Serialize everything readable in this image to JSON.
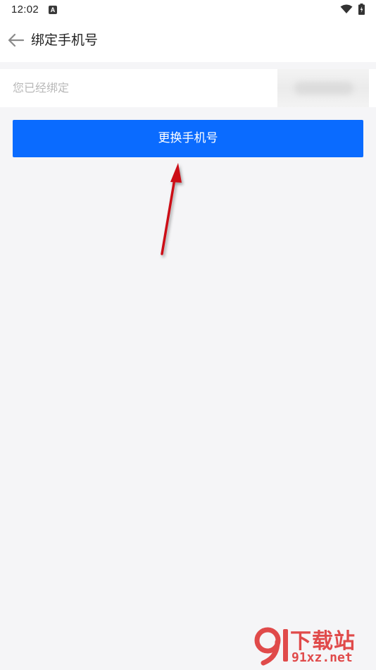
{
  "status_bar": {
    "time": "12:02",
    "notification_glyph": "A",
    "icons": [
      "notification-icon",
      "wifi-icon",
      "battery-icon"
    ]
  },
  "header": {
    "title": "绑定手机号",
    "back_icon": "arrow-left-icon"
  },
  "bound_phone": {
    "label": "您已经绑定",
    "value_hidden": true
  },
  "action": {
    "change_phone_label": "更换手机号"
  },
  "watermark": {
    "brand": "下载站",
    "url": "91xz.net"
  },
  "colors": {
    "primary_button": "#0a6bff",
    "page_background": "#f5f5f7",
    "annotation_arrow": "#d8101a",
    "watermark": "#e04a4a"
  }
}
